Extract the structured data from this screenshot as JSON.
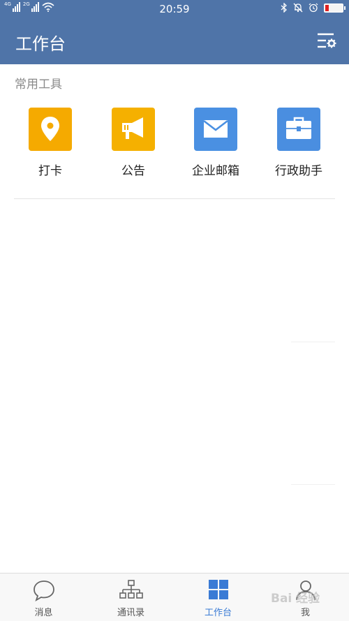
{
  "status_bar": {
    "sim1": "4G",
    "sim2": "2G",
    "time": "20:59"
  },
  "header": {
    "title": "工作台"
  },
  "section": {
    "title": "常用工具"
  },
  "tools": [
    {
      "label": "打卡",
      "icon": "location-pin-icon",
      "color": "#f5a800"
    },
    {
      "label": "公告",
      "icon": "megaphone-icon",
      "color": "#f5a800"
    },
    {
      "label": "企业邮箱",
      "icon": "mail-icon",
      "color": "#4a90e2"
    },
    {
      "label": "行政助手",
      "icon": "briefcase-icon",
      "color": "#4a90e2"
    }
  ],
  "tabbar": {
    "tabs": [
      {
        "label": "消息",
        "icon": "chat-bubble-icon"
      },
      {
        "label": "通讯录",
        "icon": "org-chart-icon"
      },
      {
        "label": "工作台",
        "icon": "grid-icon",
        "active": true
      },
      {
        "label": "我",
        "icon": "person-icon"
      }
    ]
  },
  "colors": {
    "header": "#4f74a8",
    "active_tab": "#3a7bd5",
    "battery_low": "#e02020"
  },
  "watermark": "Bai 经验"
}
